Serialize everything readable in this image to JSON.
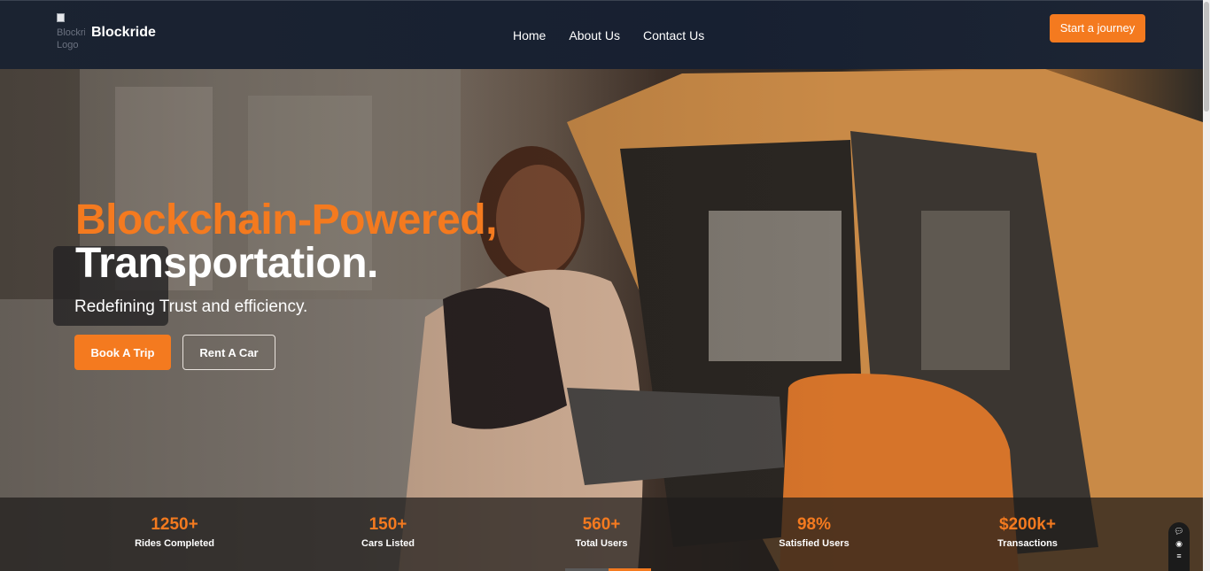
{
  "nav": {
    "logo_alt": "Blockride Logo",
    "brand": "Blockride",
    "links": [
      "Home",
      "About Us",
      "Contact Us"
    ],
    "cta": "Start a journey"
  },
  "hero": {
    "headline_1": "Blockchain-Powered,",
    "headline_2": "Transportation.",
    "subtitle": "Redefining Trust and efficiency.",
    "primary_button": "Book A Trip",
    "secondary_button": "Rent A Car"
  },
  "stats": [
    {
      "value": "1250+",
      "label": "Rides Completed"
    },
    {
      "value": "150+",
      "label": "Cars Listed"
    },
    {
      "value": "560+",
      "label": "Total Users"
    },
    {
      "value": "98%",
      "label": "Satisfied Users"
    },
    {
      "value": "$200k+",
      "label": "Transactions"
    }
  ],
  "widget": {
    "icons": [
      "chat-icon",
      "eye-icon",
      "menu-icon"
    ]
  },
  "colors": {
    "accent": "#f47a1f",
    "navbar": "#1b2331"
  }
}
